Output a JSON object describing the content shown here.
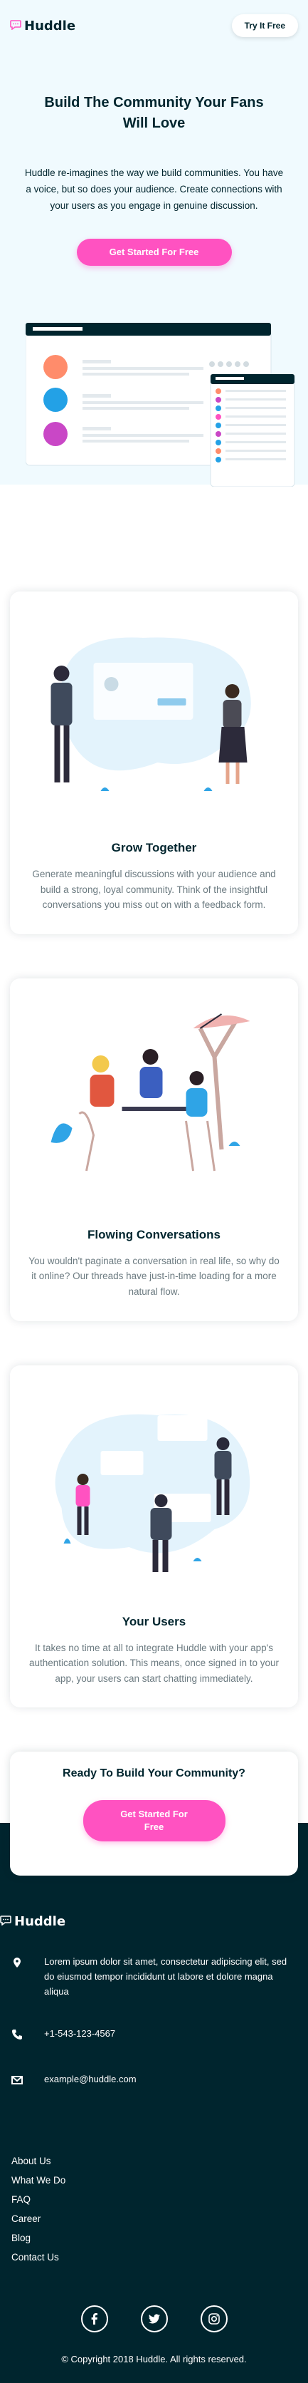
{
  "brand": {
    "name": "Huddle",
    "pink": "#ff52c1",
    "dark": "#00252e",
    "hero_bg": "#f0fafe"
  },
  "header": {
    "try_label": "Try It Free"
  },
  "hero": {
    "title": "Build The Community Your Fans Will Love",
    "description": "Huddle re-imagines the way we build communities. You have a voice, but so does your audience. Create connections with your users as you engage in genuine discussion.",
    "cta_label": "Get Started For Free"
  },
  "features": [
    {
      "title": "Grow Together",
      "text": "Generate meaningful discussions with your audience and build a strong, loyal community. Think of the insightful conversations you miss out on with a feedback form."
    },
    {
      "title": "Flowing Conversations",
      "text": "You wouldn't paginate a conversation in real life, so why do it online? Our threads have just-in-time loading for a more natural flow."
    },
    {
      "title": "Your Users",
      "text": "It takes no time at all to integrate Huddle with your app's authentication solution. This means, once signed in to your app, your users can start chatting immediately."
    }
  ],
  "ready": {
    "title": "Ready To Build Your Community?",
    "cta_label": "Get Started For Free"
  },
  "footer": {
    "address": "Lorem ipsum dolor sit amet, consectetur adipiscing elit, sed do eiusmod tempor incididunt ut labore et dolore magna aliqua",
    "phone": "+1-543-123-4567",
    "email": "example@huddle.com",
    "links": [
      "About Us",
      "What We Do",
      "FAQ",
      "Career",
      "Blog",
      "Contact Us"
    ],
    "social_icons": [
      "facebook-icon",
      "twitter-icon",
      "instagram-icon"
    ],
    "copyright": "© Copyright 2018 Huddle. All rights reserved."
  }
}
